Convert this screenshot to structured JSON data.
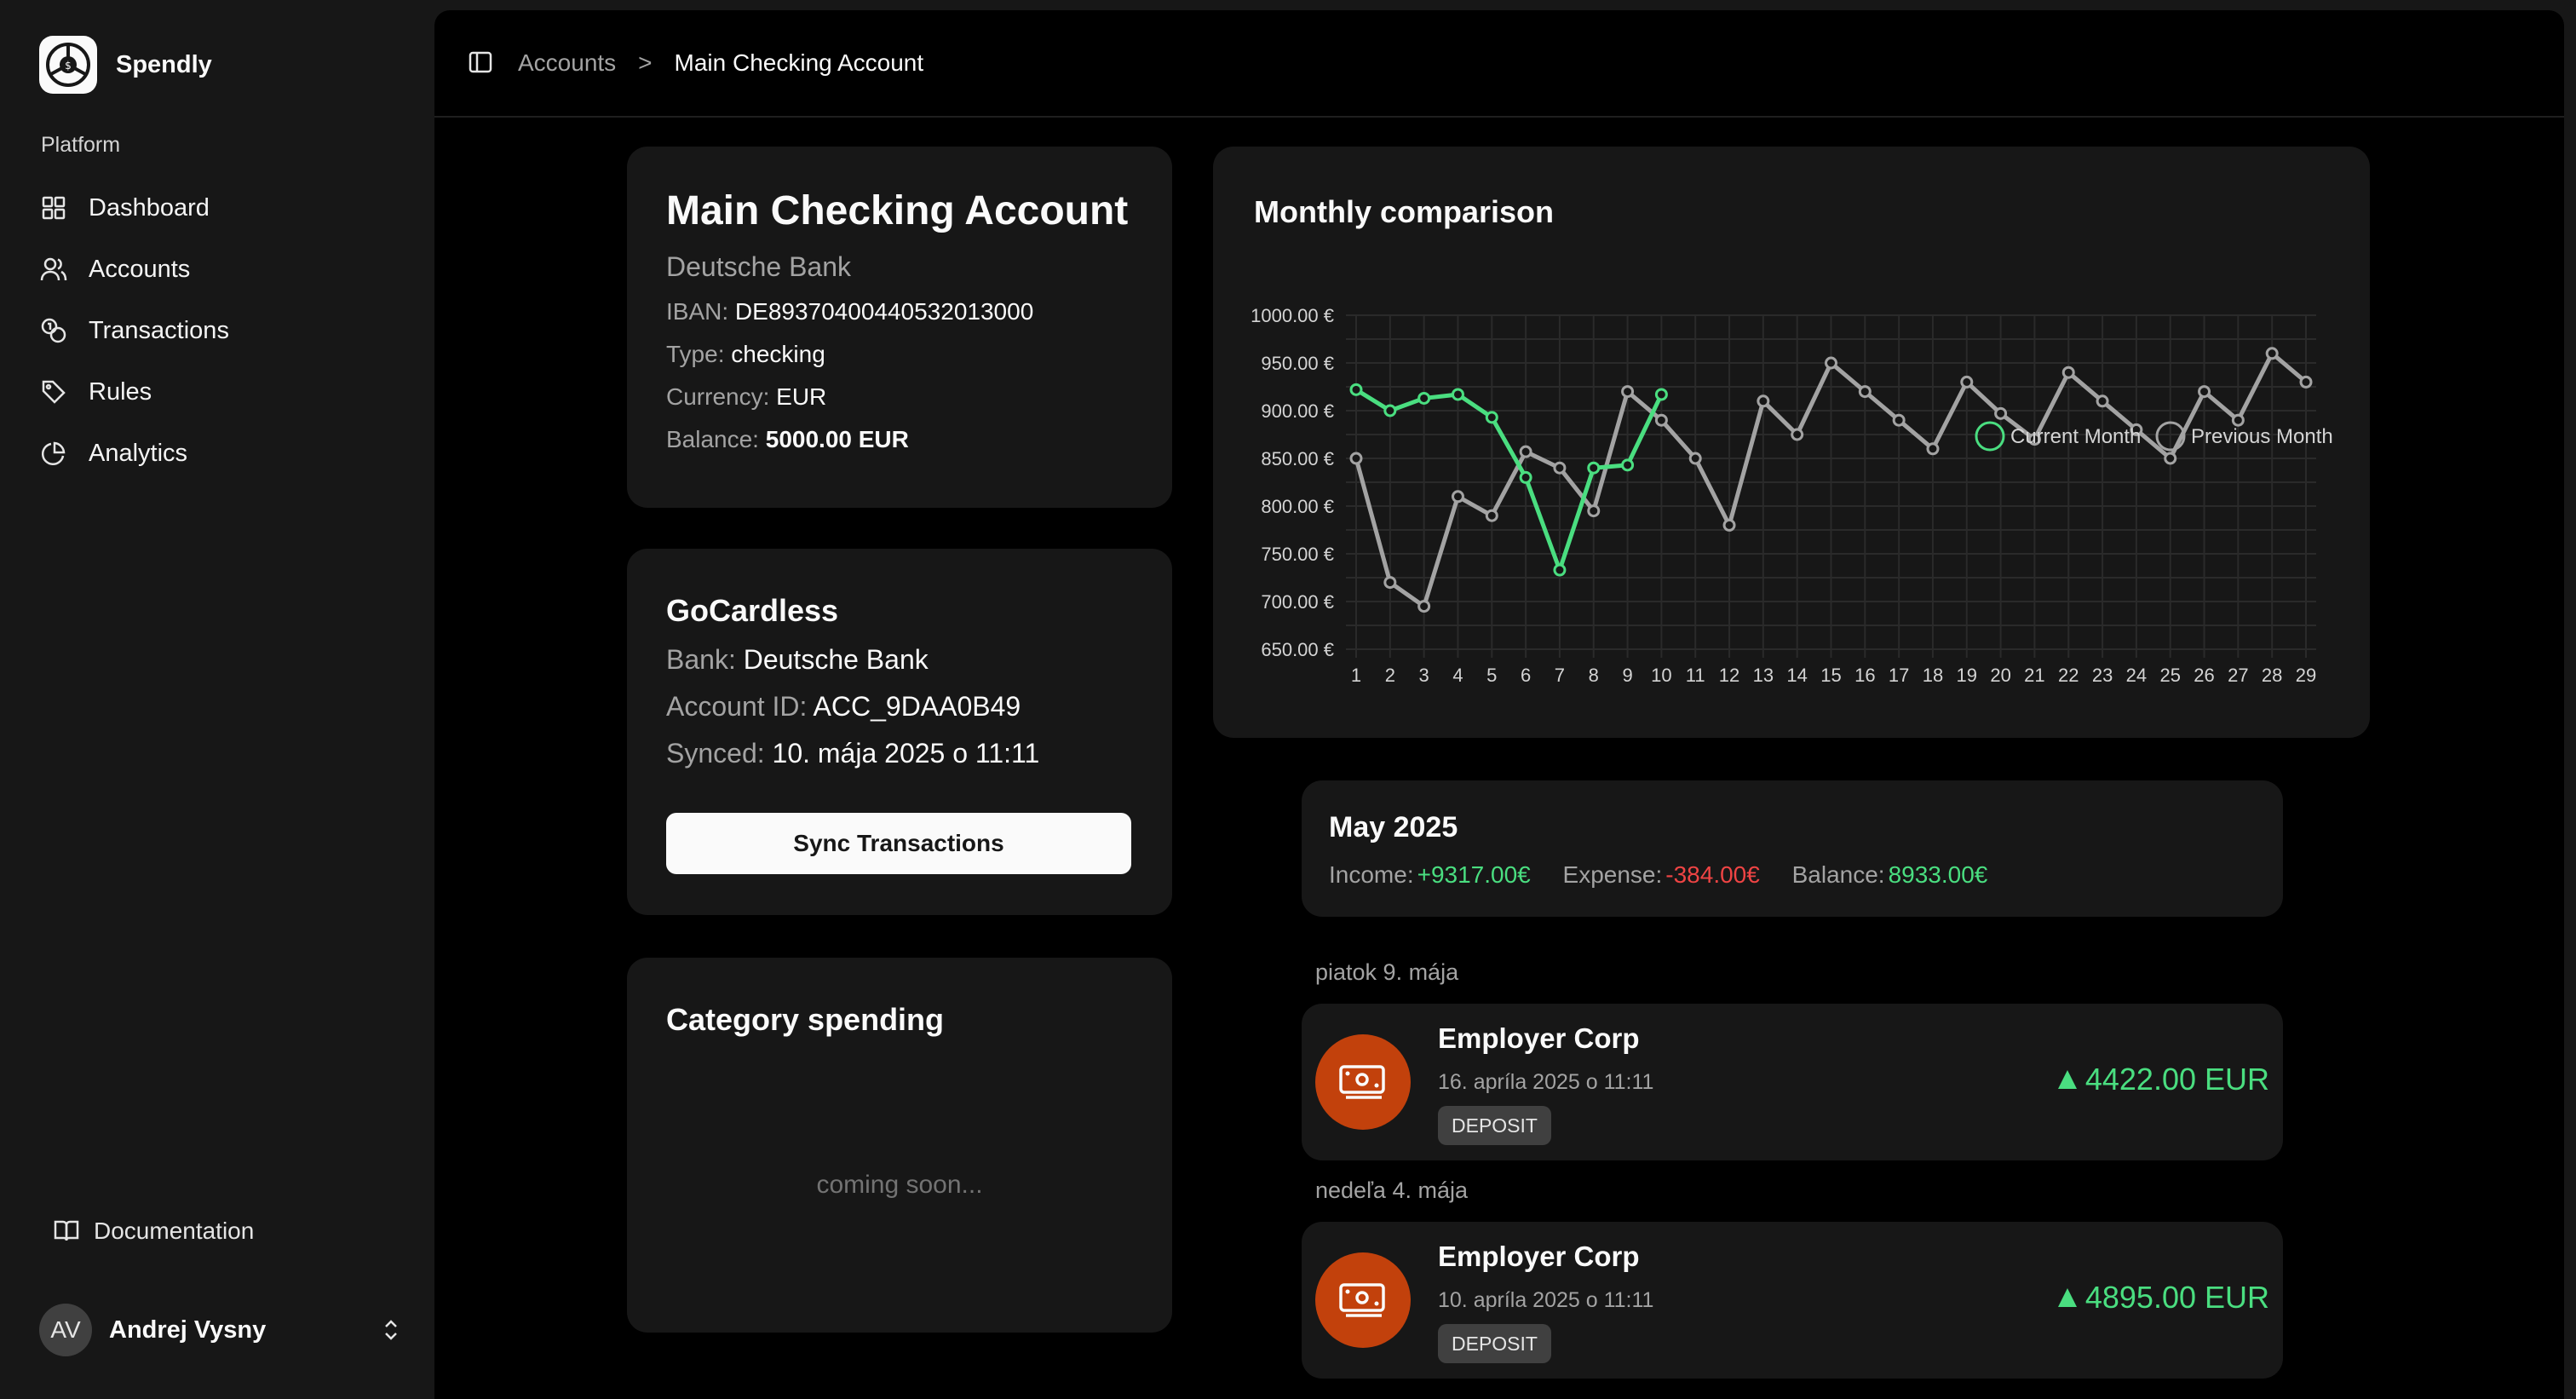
{
  "app": {
    "name": "Spendly"
  },
  "sidebar": {
    "section_label": "Platform",
    "items": [
      {
        "label": "Dashboard",
        "icon": "grid-icon"
      },
      {
        "label": "Accounts",
        "icon": "users-icon"
      },
      {
        "label": "Transactions",
        "icon": "coins-icon"
      },
      {
        "label": "Rules",
        "icon": "tag-icon"
      },
      {
        "label": "Analytics",
        "icon": "pie-chart-icon"
      }
    ],
    "documentation_label": "Documentation",
    "user": {
      "initials": "AV",
      "name": "Andrej Vysny"
    }
  },
  "breadcrumb": {
    "parent": "Accounts",
    "separator": ">",
    "current": "Main Checking Account"
  },
  "account": {
    "title": "Main Checking Account",
    "bank": "Deutsche Bank",
    "iban_label": "IBAN:",
    "iban": "DE89370400440532013000",
    "type_label": "Type:",
    "type": "checking",
    "currency_label": "Currency:",
    "currency": "EUR",
    "balance_label": "Balance:",
    "balance": "5000.00 EUR"
  },
  "gocardless": {
    "title": "GoCardless",
    "bank_label": "Bank:",
    "bank": "Deutsche Bank",
    "account_id_label": "Account ID:",
    "account_id": "ACC_9DAA0B49",
    "synced_label": "Synced:",
    "synced": "10. mája 2025 o 11:11",
    "sync_button": "Sync Transactions"
  },
  "category": {
    "title": "Category spending",
    "placeholder": "coming soon..."
  },
  "chart_data": {
    "type": "line",
    "title": "Monthly comparison",
    "x": [
      1,
      2,
      3,
      4,
      5,
      6,
      7,
      8,
      9,
      10,
      11,
      12,
      13,
      14,
      15,
      16,
      17,
      18,
      19,
      20,
      21,
      22,
      23,
      24,
      25,
      26,
      27,
      28,
      29
    ],
    "x_tick_labels": [
      "1",
      "2",
      "3",
      "4",
      "5",
      "6",
      "7",
      "8",
      "9",
      "10",
      "11",
      "12",
      "13",
      "14",
      "15",
      "16",
      "17",
      "18",
      "19",
      "20",
      "21",
      "22",
      "23",
      "24",
      "25",
      "26",
      "27",
      "28",
      "29"
    ],
    "y_tick_labels": [
      "1000.00 €",
      "950.00 €",
      "900.00 €",
      "850.00 €",
      "800.00 €",
      "750.00 €",
      "700.00 €",
      "650.00 €"
    ],
    "y_ticks": [
      1000,
      950,
      900,
      850,
      800,
      750,
      700,
      650
    ],
    "ylim": [
      650,
      1000
    ],
    "grid": true,
    "legend": "top-center",
    "series": [
      {
        "name": "Current Month",
        "color": "#4ade80",
        "x": [
          1,
          2,
          3,
          4,
          5,
          6,
          7,
          8,
          9,
          10
        ],
        "values": [
          922,
          900,
          913,
          917,
          893,
          830,
          733,
          840,
          843,
          917
        ]
      },
      {
        "name": "Previous Month",
        "color": "#a3a3a3",
        "x": [
          1,
          2,
          3,
          4,
          5,
          6,
          7,
          8,
          9,
          10,
          11,
          12,
          13,
          14,
          15,
          16,
          17,
          18,
          19,
          20,
          21,
          22,
          23,
          24,
          25,
          26,
          27,
          28,
          29
        ],
        "values": [
          850,
          720,
          695,
          810,
          790,
          857,
          840,
          795,
          920,
          890,
          850,
          780,
          910,
          875,
          950,
          920,
          890,
          860,
          930,
          897,
          870,
          940,
          910,
          880,
          850,
          920,
          890,
          960,
          930
        ]
      }
    ]
  },
  "month": {
    "title": "May 2025",
    "income_label": "Income:",
    "income": "+9317.00€",
    "expense_label": "Expense:",
    "expense": "-384.00€",
    "balance_label": "Balance:",
    "balance": "8933.00€"
  },
  "transactions": [
    {
      "day": "piatok 9. mája",
      "name": "Employer Corp",
      "date": "16. apríla 2025 o 11:11",
      "badge": "DEPOSIT",
      "amount": "4422.00 EUR"
    },
    {
      "day": "nedeľa 4. mája",
      "name": "Employer Corp",
      "date": "10. apríla 2025 o 11:11",
      "badge": "DEPOSIT",
      "amount": "4895.00 EUR"
    }
  ],
  "colors": {
    "accent_positive": "#4ade80",
    "accent_negative": "#ef4444",
    "icon_bg": "#c2410c",
    "background": "#000000",
    "card": "#171717"
  }
}
